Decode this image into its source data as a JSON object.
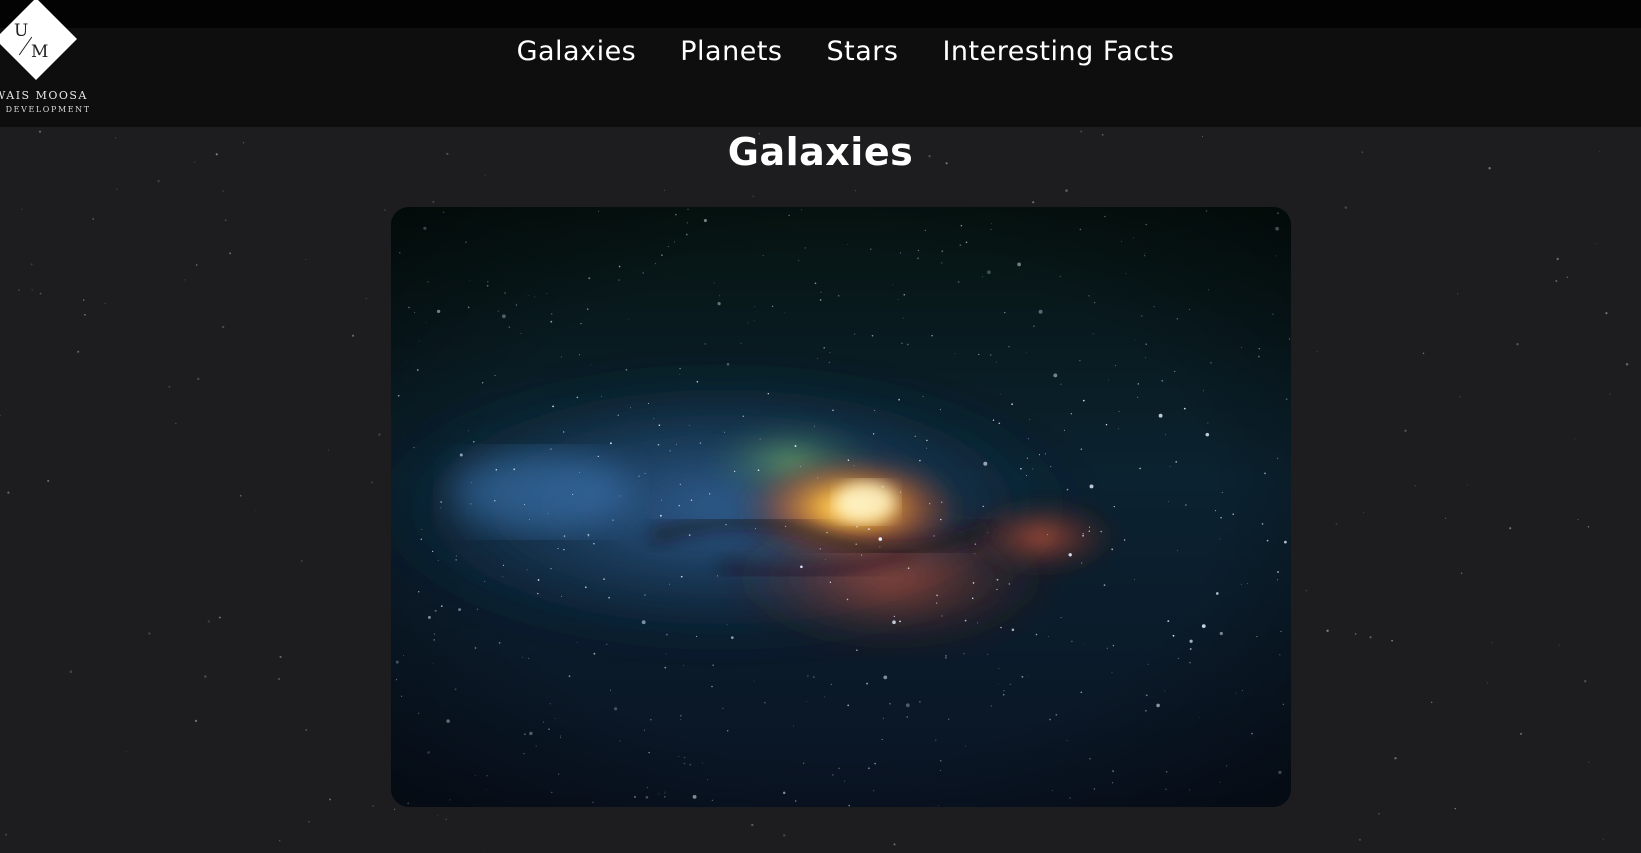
{
  "logo": {
    "monogram_top": "U",
    "monogram_bottom": "M",
    "name": "WAIS MOOSA",
    "tagline": "B DEVELOPMENT"
  },
  "nav": {
    "items": [
      {
        "label": "Galaxies"
      },
      {
        "label": "Planets"
      },
      {
        "label": "Stars"
      },
      {
        "label": "Interesting Facts"
      }
    ]
  },
  "main": {
    "title": "Galaxies"
  },
  "hero_image": {
    "subject": "milky-way-galaxy-image"
  },
  "colors": {
    "page_background": "#1d1d1f",
    "navbar_background": "#0e0e0e",
    "top_strip": "#030303",
    "text": "#ffffff"
  }
}
